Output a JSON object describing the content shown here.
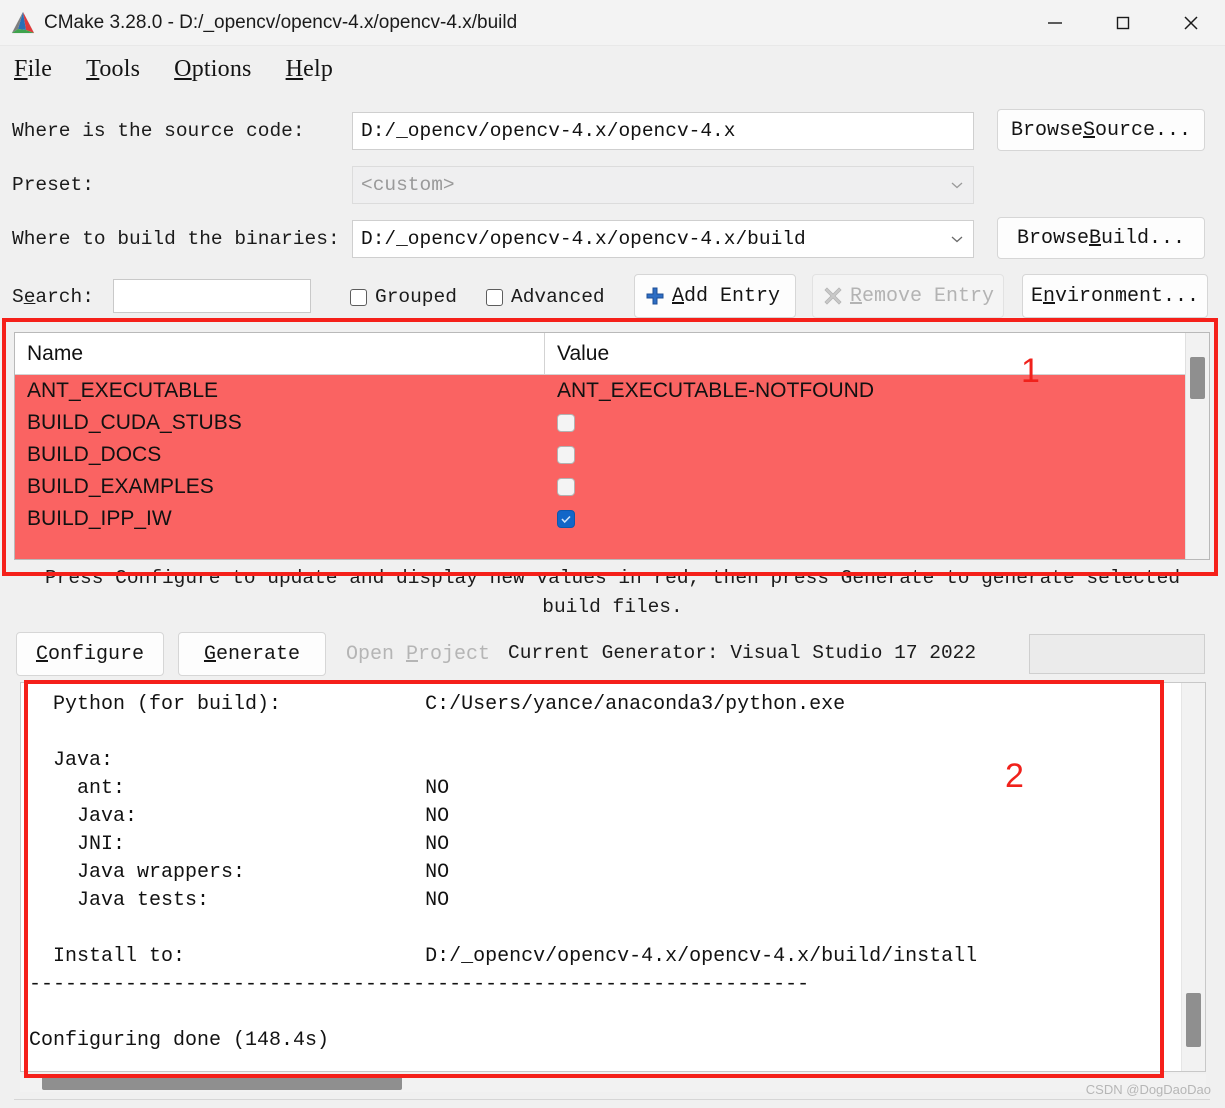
{
  "window": {
    "title": "CMake 3.28.0 - D:/_opencv/opencv-4.x/opencv-4.x/build",
    "logo_icon": "cmake-logo-icon",
    "minimize_icon": "minimize-icon",
    "maximize_icon": "maximize-icon",
    "close_icon": "close-icon"
  },
  "menu": {
    "items": [
      {
        "label": "File",
        "mnemonic": "F",
        "rest": "ile"
      },
      {
        "label": "Tools",
        "mnemonic": "T",
        "rest": "ools"
      },
      {
        "label": "Options",
        "mnemonic": "O",
        "rest": "ptions"
      },
      {
        "label": "Help",
        "mnemonic": "H",
        "rest": "elp"
      }
    ]
  },
  "paths": {
    "source_label": "Where is the source code:",
    "source_value": "D:/_opencv/opencv-4.x/opencv-4.x",
    "browse_source_pre": "Browse ",
    "browse_source_mnemonic": "S",
    "browse_source_rest": "ource...",
    "preset_label": "Preset:",
    "preset_value": "<custom>",
    "build_label": "Where to build the binaries:",
    "build_value": "D:/_opencv/opencv-4.x/opencv-4.x/build",
    "browse_build_pre": "Browse ",
    "browse_build_mnemonic": "B",
    "browse_build_rest": "uild..."
  },
  "toolbar": {
    "search_pre": "S",
    "search_mnemonic": "e",
    "search_rest": "arch:",
    "search_value": "",
    "search_placeholder": "",
    "grouped_label": "Grouped",
    "grouped_checked": false,
    "advanced_label": "Advanced",
    "advanced_checked": false,
    "add_entry_pre": "",
    "add_entry_mnemonic": "A",
    "add_entry_rest": "dd Entry",
    "add_entry_icon": "plus-icon",
    "remove_entry_pre": "",
    "remove_entry_mnemonic": "R",
    "remove_entry_rest": "emove Entry",
    "remove_entry_icon": "remove-x-icon",
    "remove_entry_disabled": true,
    "environment_pre": "E",
    "environment_mnemonic": "n",
    "environment_rest": "vironment..."
  },
  "cache_table": {
    "columns": [
      "Name",
      "Value"
    ],
    "rows": [
      {
        "name": "ANT_EXECUTABLE",
        "value": "ANT_EXECUTABLE-NOTFOUND",
        "type": "text"
      },
      {
        "name": "BUILD_CUDA_STUBS",
        "value": "",
        "type": "checkbox",
        "checked": false
      },
      {
        "name": "BUILD_DOCS",
        "value": "",
        "type": "checkbox",
        "checked": false
      },
      {
        "name": "BUILD_EXAMPLES",
        "value": "",
        "type": "checkbox",
        "checked": false
      },
      {
        "name": "BUILD_IPP_IW",
        "value": "",
        "type": "checkbox",
        "checked": true
      }
    ],
    "row_highlight_color": "#fa6362",
    "checkbox_checked_color": "#1266c8"
  },
  "hint": {
    "line1": "Press Configure to update and display new values in red, then press Generate to generate selected",
    "line2": "build files."
  },
  "actions": {
    "configure_mnemonic": "C",
    "configure_rest": "onfigure",
    "generate_mnemonic": "G",
    "generate_rest": "enerate",
    "open_project_pre": "Open ",
    "open_project_mnemonic": "P",
    "open_project_rest": "roject",
    "open_project_disabled": true,
    "current_generator": "Current Generator: Visual Studio 17 2022",
    "progress_value": ""
  },
  "log": {
    "text": "  Python (for build):            C:/Users/yance/anaconda3/python.exe\n\n  Java:\n    ant:                         NO\n    Java:                        NO\n    JNI:                         NO\n    Java wrappers:               NO\n    Java tests:                  NO\n\n  Install to:                    D:/_opencv/opencv-4.x/opencv-4.x/build/install\n-----------------------------------------------------------------\n\nConfiguring done (148.4s)"
  },
  "annotations": {
    "marker_1": "1",
    "marker_2": "2",
    "box_color": "#f5201a"
  },
  "watermark": {
    "text": "CSDN @DogDaoDao"
  }
}
